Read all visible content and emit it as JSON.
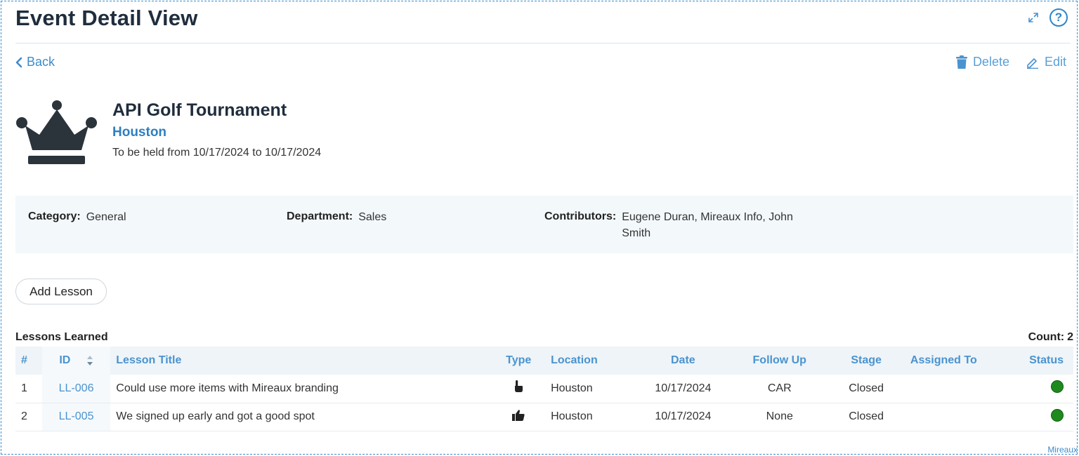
{
  "page": {
    "title": "Event Detail View"
  },
  "icons": {
    "expand": "expand-icon",
    "help": "help-icon",
    "back": "chevron-left-icon",
    "delete": "trash-icon",
    "edit": "pencil-icon",
    "event": "crown-icon",
    "sort": "sort-icon",
    "type_row1": "pointing-hand-icon",
    "type_row2": "thumbs-up-icon"
  },
  "colors": {
    "accent": "#2e86c8",
    "status_green": "#1e8a1e",
    "panel_bg": "#f3f8fb"
  },
  "nav": {
    "back_label": "Back",
    "delete_label": "Delete",
    "edit_label": "Edit"
  },
  "event": {
    "name": "API Golf Tournament",
    "location": "Houston",
    "dates": "To be held from 10/17/2024 to 10/17/2024"
  },
  "info": {
    "category_label": "Category:",
    "category_value": "General",
    "department_label": "Department:",
    "department_value": "Sales",
    "contributors_label": "Contributors:",
    "contributors_value": "Eugene Duran, Mireaux Info, John Smith"
  },
  "buttons": {
    "add_lesson": "Add Lesson"
  },
  "lessons": {
    "title": "Lessons Learned",
    "count_label": "Count:",
    "count_value": "2",
    "columns": {
      "num": "#",
      "id": "ID",
      "title": "Lesson Title",
      "type": "Type",
      "location": "Location",
      "date": "Date",
      "follow_up": "Follow Up",
      "stage": "Stage",
      "assigned_to": "Assigned To",
      "status": "Status"
    },
    "rows": [
      {
        "num": "1",
        "id": "LL-006",
        "title": "Could use more items with Mireaux branding",
        "location": "Houston",
        "date": "10/17/2024",
        "follow_up": "CAR",
        "stage": "Closed",
        "assigned_to": "",
        "status": "green"
      },
      {
        "num": "2",
        "id": "LL-005",
        "title": "We signed up early and got a good spot",
        "location": "Houston",
        "date": "10/17/2024",
        "follow_up": "None",
        "stage": "Closed",
        "assigned_to": "",
        "status": "green"
      }
    ]
  },
  "footer": {
    "brand": "Mireaux"
  }
}
